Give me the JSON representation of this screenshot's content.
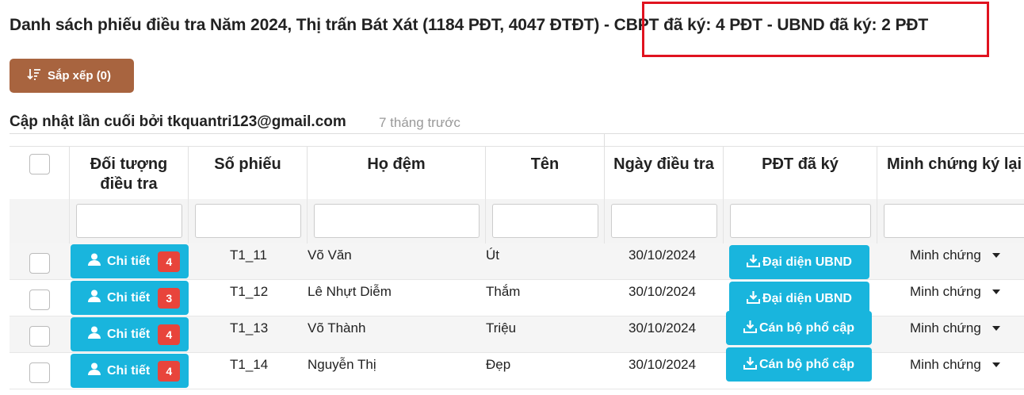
{
  "title": "Danh sách phiếu điều tra Năm 2024, Thị trấn Bát Xát (1184 PĐT, 4047 ĐTĐT) - CBPT đã ký: 4 PĐT - UBND đã ký: 2 PĐT",
  "colors": {
    "accent": "#19b5dd",
    "sort_button": "#a8643f",
    "badge": "#e8443b",
    "highlight": "#e0131f"
  },
  "toolbar": {
    "sort_label": "Sắp xếp (0)",
    "sort_icon": "sort-descending-icon"
  },
  "update": {
    "label": "Cập nhật lần cuối bởi tkquantri123@gmail.com",
    "time": "7 tháng trước"
  },
  "columns": {
    "subject": "Đối tượng\nđiều tra",
    "form_no": "Số phiếu",
    "last_name": "Họ đệm",
    "first_name": "Tên",
    "date": "Ngày điều tra",
    "signed": "PĐT đã ký",
    "evidence": "Minh chứng ký lại"
  },
  "rows": [
    {
      "detail_label": "Chi tiết",
      "count": "4",
      "form_no": "T1_11",
      "last_name": "Võ Văn",
      "first_name": "Út",
      "date": "30/10/2024",
      "signed": "Đại diện UBND",
      "evidence": "Minh chứng"
    },
    {
      "detail_label": "Chi tiết",
      "count": "3",
      "form_no": "T1_12",
      "last_name": "Lê Nhựt Diễm",
      "first_name": "Thắm",
      "date": "30/10/2024",
      "signed": "Đại diện UBND",
      "evidence": "Minh chứng"
    },
    {
      "detail_label": "Chi tiết",
      "count": "4",
      "form_no": "T1_13",
      "last_name": "Võ Thành",
      "first_name": "Triệu",
      "date": "30/10/2024",
      "signed": "Cán bộ phổ cập",
      "evidence": "Minh chứng"
    },
    {
      "detail_label": "Chi tiết",
      "count": "4",
      "form_no": "T1_14",
      "last_name": "Nguyễn Thị",
      "first_name": "Đẹp",
      "date": "30/10/2024",
      "signed": "Cán bộ phổ cập",
      "evidence": "Minh chứng"
    }
  ]
}
